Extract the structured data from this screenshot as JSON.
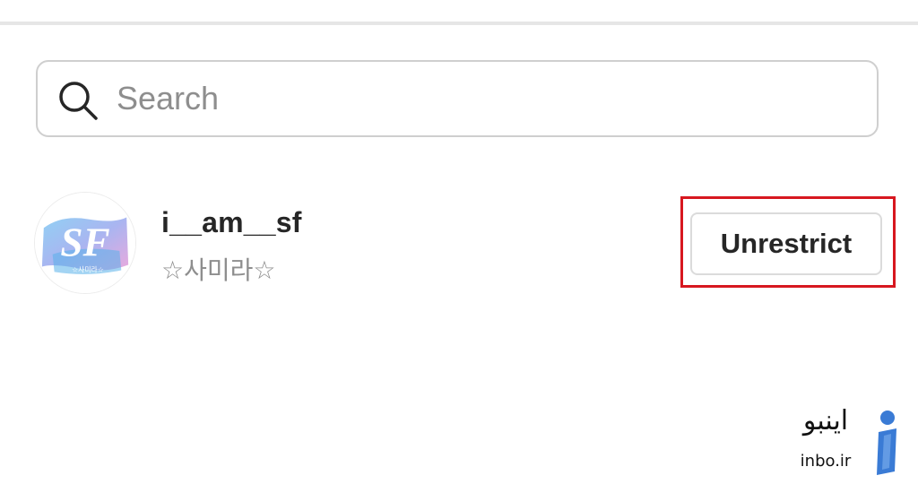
{
  "search": {
    "placeholder": "Search",
    "icon": "search-icon"
  },
  "results": [
    {
      "username": "i__am__sf",
      "full_name": "☆사미라☆",
      "avatar_text": "SF",
      "avatar_caption": "☆사미라☆",
      "action_label": "Unrestrict"
    }
  ],
  "watermark": {
    "text": "اینبو",
    "domain": "inbo.ir"
  },
  "colors": {
    "text_primary": "#262626",
    "text_secondary": "#8e8e8e",
    "border": "#dbdbdb",
    "highlight": "#d7171f",
    "watermark_logo": "#3a7bd5"
  }
}
